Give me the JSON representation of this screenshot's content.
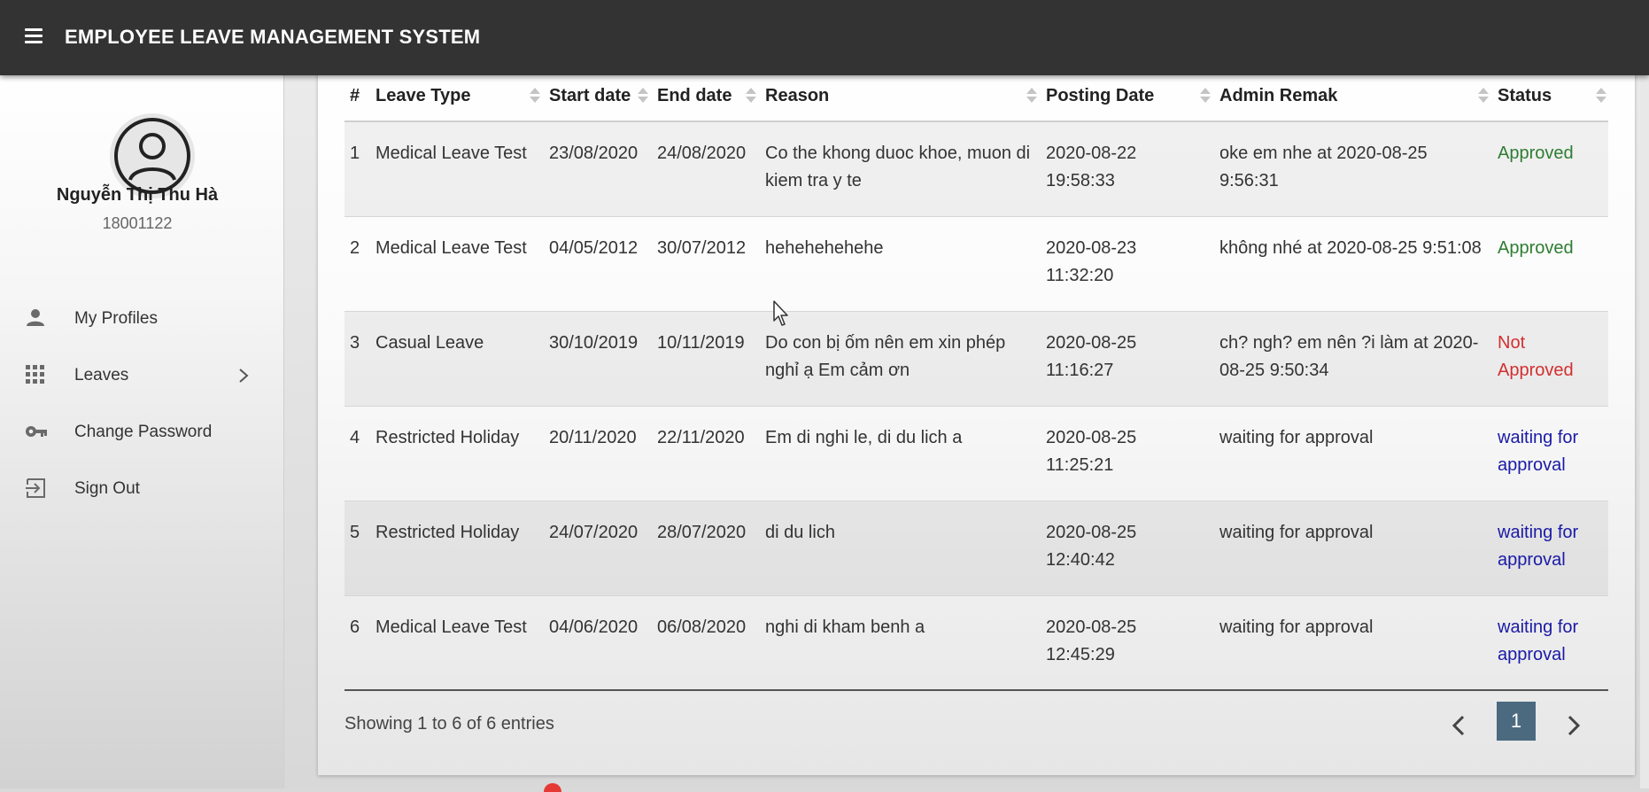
{
  "header": {
    "title": "EMPLOYEE LEAVE MANAGEMENT SYSTEM"
  },
  "sidebar": {
    "user_name": "Nguyễn Thị Thu Hà",
    "user_id": "18001122",
    "items": [
      {
        "label": "My Profiles",
        "icon": "person-icon"
      },
      {
        "label": "Leaves",
        "icon": "grid-icon"
      },
      {
        "label": "Change Password",
        "icon": "key-icon"
      },
      {
        "label": "Sign Out",
        "icon": "sign-out-icon"
      }
    ]
  },
  "table": {
    "columns": [
      "#",
      "Leave Type",
      "Start date",
      "End date",
      "Reason",
      "Posting Date",
      "Admin Remak",
      "Status"
    ],
    "rows": [
      {
        "num": "1",
        "type": "Medical Leave Test",
        "start": "23/08/2020",
        "end": "24/08/2020",
        "reason": "Co the khong duoc khoe, muon di kiem tra y te",
        "posting": "2020-08-22 19:58:33",
        "remark": "oke em nhe at 2020-08-25 9:56:31",
        "status": "Approved"
      },
      {
        "num": "2",
        "type": "Medical Leave Test",
        "start": "04/05/2012",
        "end": "30/07/2012",
        "reason": "hehehehehehe",
        "posting": "2020-08-23 11:32:20",
        "remark": "không nhé at 2020-08-25 9:51:08",
        "status": "Approved"
      },
      {
        "num": "3",
        "type": "Casual Leave",
        "start": "30/10/2019",
        "end": "10/11/2019",
        "reason": "Do con bị ốm nên em xin phép nghỉ ạ Em cảm ơn",
        "posting": "2020-08-25 11:16:27",
        "remark": "ch? ngh? em nên ?i làm at 2020-08-25 9:50:34",
        "status": "Not Approved"
      },
      {
        "num": "4",
        "type": "Restricted Holiday",
        "start": "20/11/2020",
        "end": "22/11/2020",
        "reason": "Em di nghi le, di du lich a",
        "posting": "2020-08-25 11:25:21",
        "remark": "waiting for approval",
        "status": "waiting for approval"
      },
      {
        "num": "5",
        "type": "Restricted Holiday",
        "start": "24/07/2020",
        "end": "28/07/2020",
        "reason": "di du lich",
        "posting": "2020-08-25 12:40:42",
        "remark": "waiting for approval",
        "status": "waiting for approval"
      },
      {
        "num": "6",
        "type": "Medical Leave Test",
        "start": "04/06/2020",
        "end": "06/08/2020",
        "reason": "nghi di kham benh a",
        "posting": "2020-08-25 12:45:29",
        "remark": "waiting for approval",
        "status": "waiting for approval"
      }
    ]
  },
  "footer": {
    "info": "Showing 1 to 6 of 6 entries",
    "current_page": "1"
  },
  "colors": {
    "topbar": "#333333",
    "approved": "#2e7d32",
    "not_approved": "#d32f2f",
    "waiting": "#1a1aa6",
    "page_active": "#4b6a80"
  }
}
